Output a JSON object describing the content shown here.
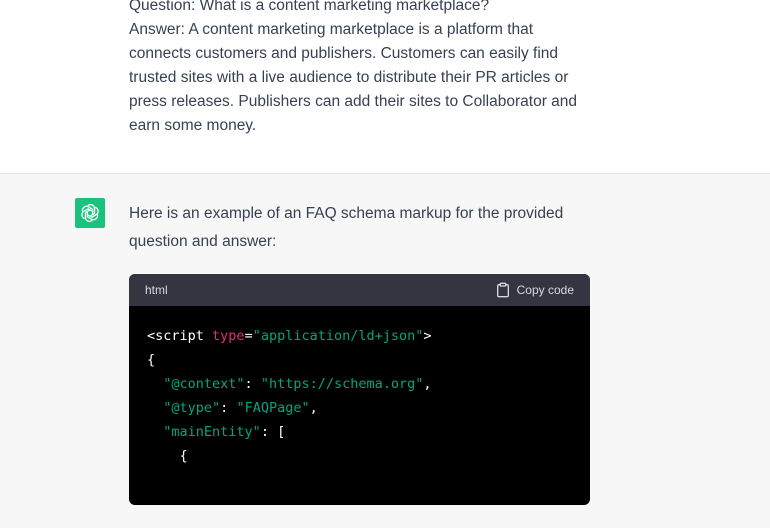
{
  "user": {
    "lines": [
      "Question: What is a content marketing marketplace?",
      "Answer: A content marketing marketplace is a platform that",
      "connects customers and publishers. Customers can easily find",
      "trusted sites with a live audience to distribute their PR articles or",
      "press releases. Publishers can add their sites to Collaborator and",
      "earn some money."
    ]
  },
  "assistant": {
    "avatar_icon": "openai-logo-icon",
    "intro_lines": [
      "Here is an example of an FAQ schema markup for the provided",
      "question and answer:"
    ],
    "code": {
      "language": "html",
      "copy_label": "Copy code",
      "copy_icon": "clipboard-icon",
      "line1_open": "<script",
      "line1_attr": "type",
      "line1_eq": "=",
      "line1_val": "\"application/ld+json\"",
      "line1_close": ">",
      "line2": "{",
      "line3_key": "\"@context\"",
      "line3_sep": ": ",
      "line3_val": "\"https://schema.org\"",
      "line3_end": ",",
      "line4_key": "\"@type\"",
      "line4_sep": ": ",
      "line4_val": "\"FAQPage\"",
      "line4_end": ",",
      "line5_key": "\"mainEntity\"",
      "line5_sep": ": ",
      "line5_bracket": "[",
      "line6": "{"
    }
  },
  "colors": {
    "avatar_bg": "#19c37d",
    "code_bg": "#000000",
    "code_header_bg": "#343541",
    "string": "#00a67d",
    "attr": "#df3079"
  }
}
